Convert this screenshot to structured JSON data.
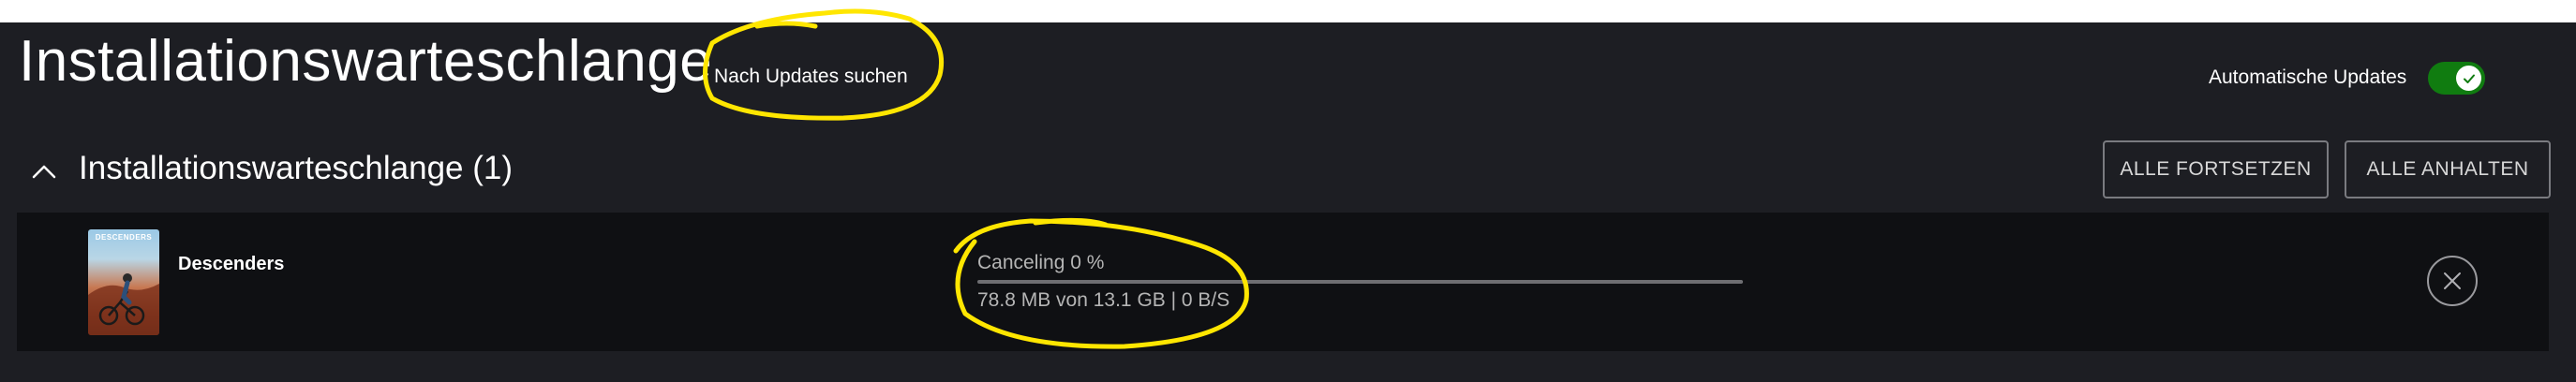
{
  "header": {
    "title": "Installationswarteschlange",
    "check_updates_label": "Nach Updates suchen",
    "auto_updates_label": "Automatische Updates",
    "auto_updates_enabled": true
  },
  "queue_section": {
    "title": "Installationswarteschlange (1)",
    "resume_all_label": "ALLE FORTSETZEN",
    "pause_all_label": "ALLE ANHALTEN"
  },
  "queue_items": [
    {
      "name": "Descenders",
      "thumbnail_text": "DESCENDERS",
      "status": "Canceling 0 %",
      "progress_fraction": 0.0,
      "size_info": "78.8 MB von 13.1 GB | 0 B/S"
    }
  ],
  "colors": {
    "toggle_on": "#107c10",
    "annotation": "#ffe600",
    "background": "#1d1e23"
  },
  "icons": {
    "chevron": "chevron-up-icon",
    "toggle_check": "check-icon",
    "cancel": "close-icon"
  }
}
